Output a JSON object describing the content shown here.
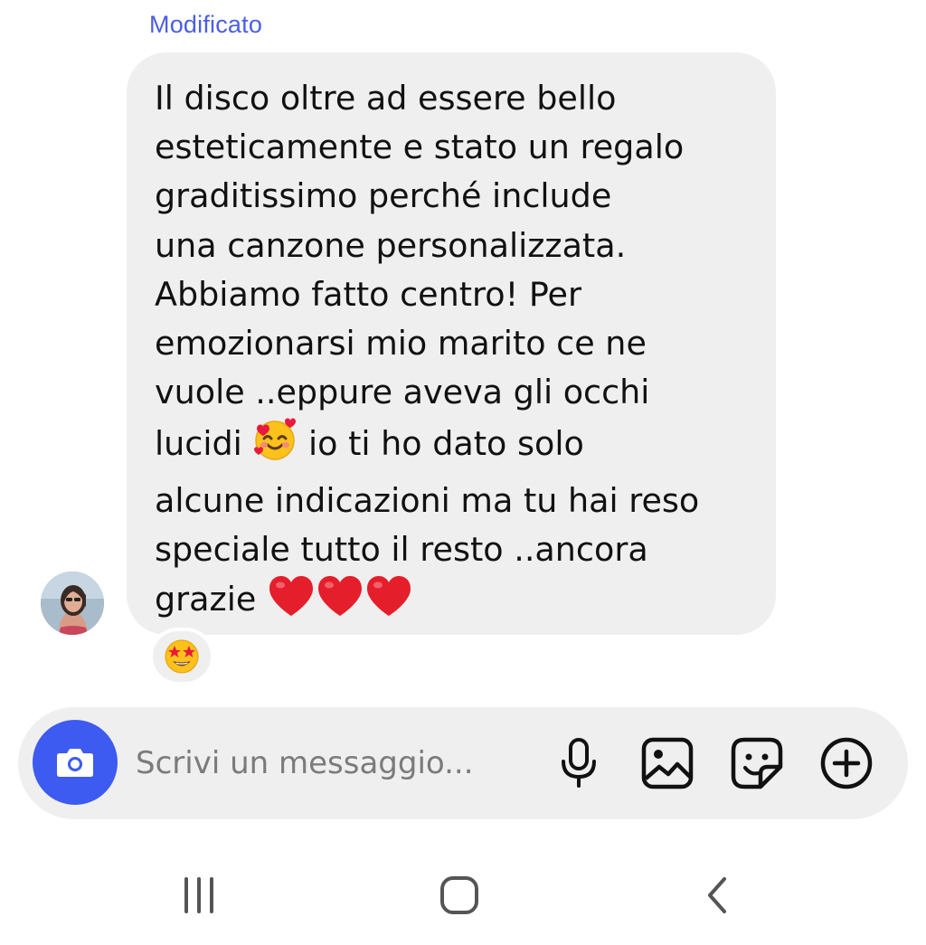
{
  "message": {
    "edited_label": "Modificato",
    "lines": [
      "Il disco oltre ad essere bello",
      "esteticamente e stato un regalo",
      "graditissimo perché include",
      "una canzone personalizzata.",
      "Abbiamo fatto centro! Per",
      "emozionarsi mio marito ce ne",
      "vuole ..eppure aveva gli occhi",
      "lucidi",
      "io ti ho dato solo",
      "alcune indicazioni ma tu hai reso",
      "speciale tutto il resto ..ancora",
      "grazie"
    ],
    "inline_emoji": "smiling-face-with-hearts",
    "trailing_emoji": [
      "red-heart",
      "red-heart",
      "red-heart"
    ],
    "reaction_emoji": "star-struck",
    "bubble_color": "#efefef"
  },
  "composer": {
    "placeholder": "Scrivi un messaggio...",
    "accent_color": "#3d5af1",
    "icons": [
      "camera-icon",
      "microphone-icon",
      "image-icon",
      "sticker-icon",
      "plus-circle-icon"
    ]
  },
  "nav": {
    "icons": [
      "recent-apps-icon",
      "home-icon",
      "back-icon"
    ]
  },
  "colors": {
    "edited_label": "#4a5ee6",
    "text": "#111111"
  }
}
